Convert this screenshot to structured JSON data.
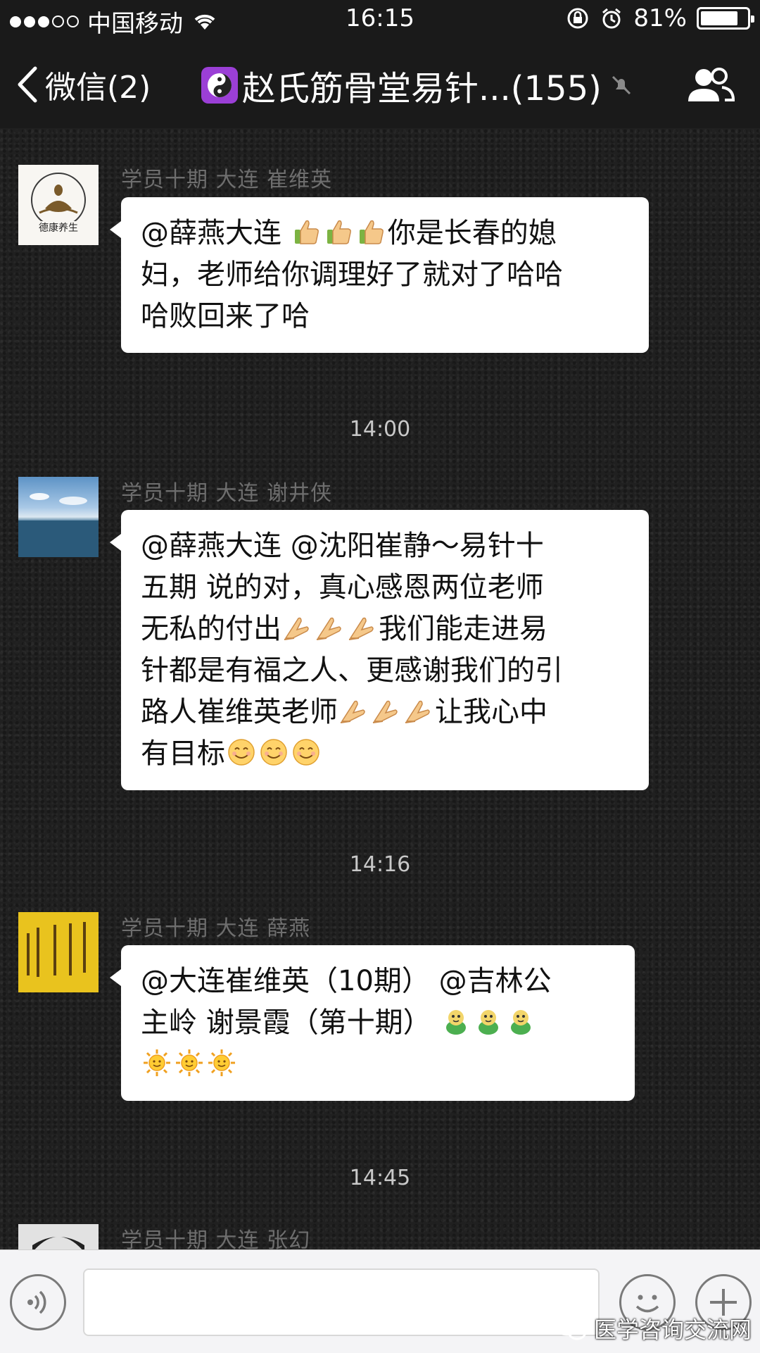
{
  "status_bar": {
    "carrier": "中国移动",
    "time": "16:15",
    "battery": "81%",
    "battery_level": 0.81
  },
  "nav": {
    "back_label": "微信(2)",
    "group_title": "赵氏筋骨堂易针...(155)"
  },
  "messages": [
    {
      "sender": "学员十期  大连  崔维英",
      "avatar_label": "德康养生",
      "lines": [
        [
          {
            "t": "text",
            "v": "@薛燕大连 "
          },
          {
            "t": "emoji",
            "v": "thumbs-up-emoji"
          },
          {
            "t": "emoji",
            "v": "thumbs-up-emoji"
          },
          {
            "t": "emoji",
            "v": "thumbs-up-emoji"
          },
          {
            "t": "text",
            "v": "你是长春的媳"
          }
        ],
        [
          {
            "t": "text",
            "v": "妇，老师给你调理好了就对了哈哈"
          }
        ],
        [
          {
            "t": "text",
            "v": "哈败回来了哈"
          }
        ]
      ]
    },
    {
      "time_before": "14:00",
      "sender": "学员十期  大连  谢井侠",
      "lines": [
        [
          {
            "t": "text",
            "v": "@薛燕大连 @沈阳崔静～易针十"
          }
        ],
        [
          {
            "t": "text",
            "v": "五期 说的对，真心感恩两位老师"
          }
        ],
        [
          {
            "t": "text",
            "v": "无私的付出"
          },
          {
            "t": "emoji",
            "v": "pray-emoji"
          },
          {
            "t": "emoji",
            "v": "pray-emoji"
          },
          {
            "t": "emoji",
            "v": "pray-emoji"
          },
          {
            "t": "text",
            "v": "我们能走进易"
          }
        ],
        [
          {
            "t": "text",
            "v": "针都是有福之人、更感谢我们的引"
          }
        ],
        [
          {
            "t": "text",
            "v": "路人崔维英老师"
          },
          {
            "t": "emoji",
            "v": "pray-emoji"
          },
          {
            "t": "emoji",
            "v": "pray-emoji"
          },
          {
            "t": "emoji",
            "v": "pray-emoji"
          },
          {
            "t": "text",
            "v": "让我心中"
          }
        ],
        [
          {
            "t": "text",
            "v": "有目标"
          },
          {
            "t": "emoji",
            "v": "smile-emoji"
          },
          {
            "t": "emoji",
            "v": "smile-emoji"
          },
          {
            "t": "emoji",
            "v": "smile-emoji"
          }
        ]
      ]
    },
    {
      "time_before": "14:16",
      "sender": "学员十期  大连  薛燕",
      "lines": [
        [
          {
            "t": "text",
            "v": "@大连崔维英（10期） @吉林公"
          }
        ],
        [
          {
            "t": "text",
            "v": "主岭  谢景霞（第十期） "
          },
          {
            "t": "emoji",
            "v": "frog-emoji"
          },
          {
            "t": "emoji",
            "v": "frog-emoji"
          },
          {
            "t": "emoji",
            "v": "frog-emoji"
          }
        ],
        [
          {
            "t": "emoji",
            "v": "sun-emoji"
          },
          {
            "t": "emoji",
            "v": "sun-emoji"
          },
          {
            "t": "emoji",
            "v": "sun-emoji"
          }
        ]
      ]
    },
    {
      "time_before": "14:45",
      "sender": "学员十期  大连  张幻"
    }
  ],
  "watermark": "医学咨询交流网",
  "colors": {
    "chat_background": "#202020",
    "bubble": "#ffffff",
    "sender_text": "#6e6e6e",
    "nav_background": "#1a1a1a",
    "taiji_badge": "#9b3fd6"
  }
}
